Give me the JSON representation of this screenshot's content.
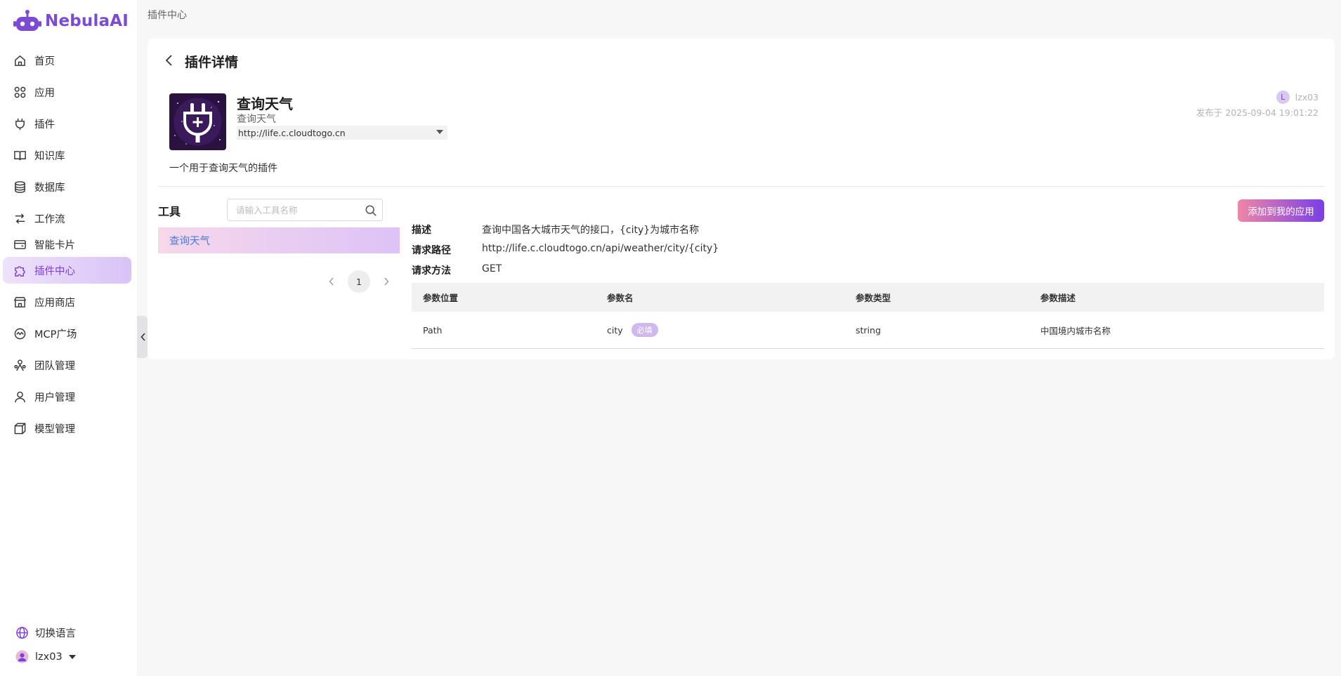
{
  "brand": {
    "name": "NebulaAI",
    "accent": "#7a3fe4"
  },
  "sidebar": {
    "items": [
      {
        "label": "首页",
        "icon": "home-icon"
      },
      {
        "label": "应用",
        "icon": "apps-grid-icon"
      },
      {
        "label": "插件",
        "icon": "plug-icon"
      },
      {
        "label": "知识库",
        "icon": "book-icon"
      },
      {
        "label": "数据库",
        "icon": "database-icon"
      },
      {
        "label": "工作流",
        "icon": "workflow-icon"
      },
      {
        "label": "智能卡片",
        "icon": "card-icon"
      },
      {
        "label": "插件中心",
        "icon": "puzzle-icon",
        "active": true
      },
      {
        "label": "应用商店",
        "icon": "store-icon"
      },
      {
        "label": "MCP广场",
        "icon": "mcp-icon"
      },
      {
        "label": "团队管理",
        "icon": "team-icon"
      },
      {
        "label": "用户管理",
        "icon": "user-icon"
      },
      {
        "label": "模型管理",
        "icon": "cube-icon"
      }
    ],
    "language_label": "切换语言",
    "user_name": "lzx03"
  },
  "breadcrumb": "插件中心",
  "page": {
    "title": "插件详情"
  },
  "plugin": {
    "name": "查询天气",
    "subtitle": "查询天气",
    "url": "http://life.c.cloudtogo.cn",
    "description": "一个用于查询天气的插件",
    "author_initial": "L",
    "author_name": "lzx03",
    "published": "发布于 2025-09-04 19:01:22"
  },
  "tools": {
    "label": "工具",
    "search_placeholder": "请输入工具名称",
    "items": [
      "查询天气"
    ],
    "current_page": "1"
  },
  "detail": {
    "add_button": "添加到我的应用",
    "desc_label": "描述",
    "desc_value": "查询中国各大城市天气的接口，{city}为城市名称",
    "path_label": "请求路径",
    "path_value": "http://life.c.cloudtogo.cn/api/weather/city/{city}",
    "method_label": "请求方法",
    "method_value": "GET",
    "table": {
      "headers": [
        "参数位置",
        "参数名",
        "参数类型",
        "参数描述"
      ],
      "rows": [
        {
          "position": "Path",
          "name": "city",
          "required": "必填",
          "type": "string",
          "desc": "中国境内城市名称"
        }
      ]
    }
  }
}
